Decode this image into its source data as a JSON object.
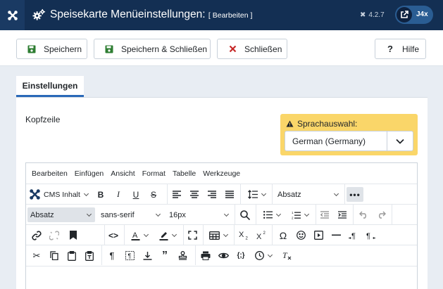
{
  "header": {
    "title": "Speisekarte Menüeinstellungen:",
    "subtitle": "[ Bearbeiten ]",
    "version": "4.2.7",
    "user": "J4x"
  },
  "toolbar": {
    "save_label": "Speichern",
    "save_close_label": "Speichern & Schließen",
    "close_label": "Schließen",
    "help_label": "Hilfe"
  },
  "tabs": [
    {
      "label": "Einstellungen"
    }
  ],
  "form": {
    "kopfzeile_label": "Kopfzeile",
    "lang_label": "Sprachauswahl:",
    "lang_value": "German (Germany)"
  },
  "editor": {
    "menu": [
      "Bearbeiten",
      "Einfügen",
      "Ansicht",
      "Format",
      "Tabelle",
      "Werkzeuge"
    ],
    "cms_content_label": "CMS Inhalt",
    "block_format": "Absatz",
    "style_format": "Absatz",
    "font_family": "sans-serif",
    "font_size": "16px"
  },
  "colors": {
    "header_bg": "#132f53",
    "accent": "#2a69b8",
    "lang_box": "#fad669",
    "save_icon": "#2e7d32",
    "close_icon": "#c62828"
  }
}
